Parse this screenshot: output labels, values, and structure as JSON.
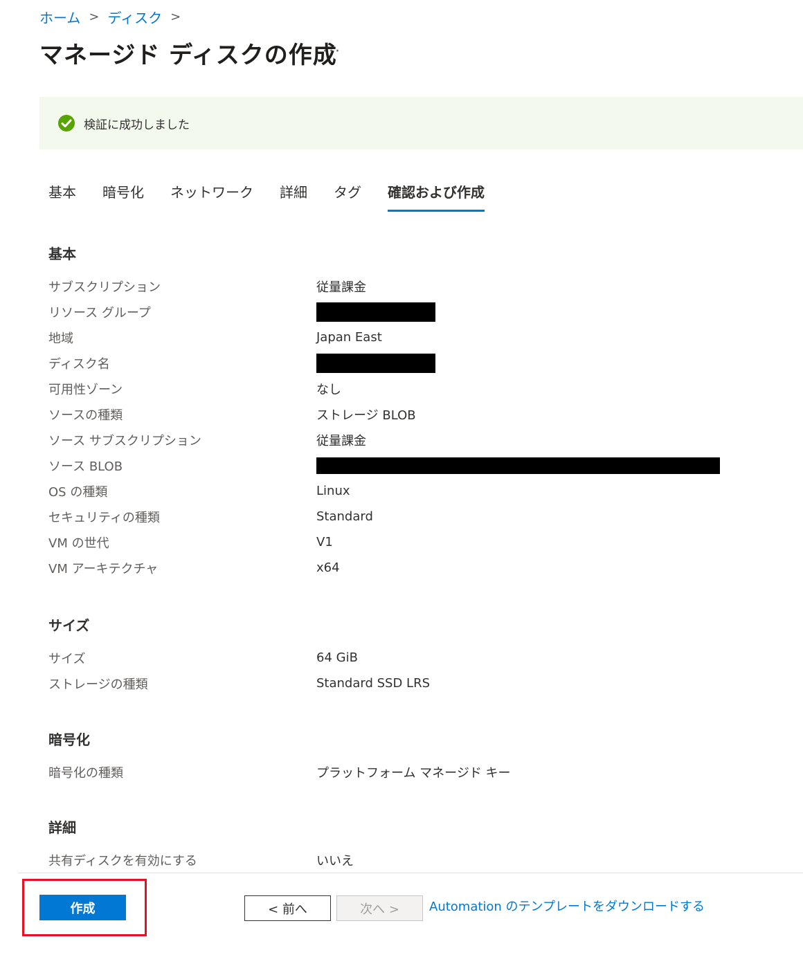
{
  "breadcrumb": {
    "items": [
      "ホーム",
      "ディスク"
    ],
    "separator": ">"
  },
  "page_title": "マネージド ディスクの作成",
  "more_label": "···",
  "banner": {
    "text": "検証に成功しました",
    "icon": "check-circle-icon",
    "color": "#57a300"
  },
  "tabs": [
    "基本",
    "暗号化",
    "ネットワーク",
    "詳細",
    "タグ",
    "確認および作成"
  ],
  "active_tab": "確認および作成",
  "sections": {
    "basic": {
      "heading": "基本",
      "rows": [
        {
          "label": "サブスクリプション",
          "value": "従量課金"
        },
        {
          "label": "リソース グループ",
          "value": "",
          "redacted": true
        },
        {
          "label": "地域",
          "value": "Japan East"
        },
        {
          "label": "ディスク名",
          "value": "",
          "redacted": true
        },
        {
          "label": "可用性ゾーン",
          "value": "なし"
        },
        {
          "label": "ソースの種類",
          "value": "ストレージ BLOB"
        },
        {
          "label": "ソース サブスクリプション",
          "value": "従量課金"
        },
        {
          "label": "ソース BLOB",
          "value": "",
          "redacted": true
        },
        {
          "label": "OS の種類",
          "value": "Linux"
        },
        {
          "label": "セキュリティの種類",
          "value": "Standard"
        },
        {
          "label": "VM の世代",
          "value": "V1"
        },
        {
          "label": "VM アーキテクチャ",
          "value": "x64"
        }
      ]
    },
    "size": {
      "heading": "サイズ",
      "rows": [
        {
          "label": "サイズ",
          "value": "64 GiB"
        },
        {
          "label": "ストレージの種類",
          "value": "Standard SSD LRS"
        }
      ]
    },
    "encryption": {
      "heading": "暗号化",
      "rows": [
        {
          "label": "暗号化の種類",
          "value": "プラットフォーム マネージド キー"
        }
      ]
    },
    "details": {
      "heading": "詳細",
      "rows": [
        {
          "label": "共有ディスクを有効にする",
          "value": "いいえ"
        }
      ]
    }
  },
  "footer": {
    "create_label": "作成",
    "prev_label": "< 前へ",
    "next_label": "次へ >",
    "template_link": "Automation のテンプレートをダウンロードする",
    "highlight_color": "#e81123"
  }
}
